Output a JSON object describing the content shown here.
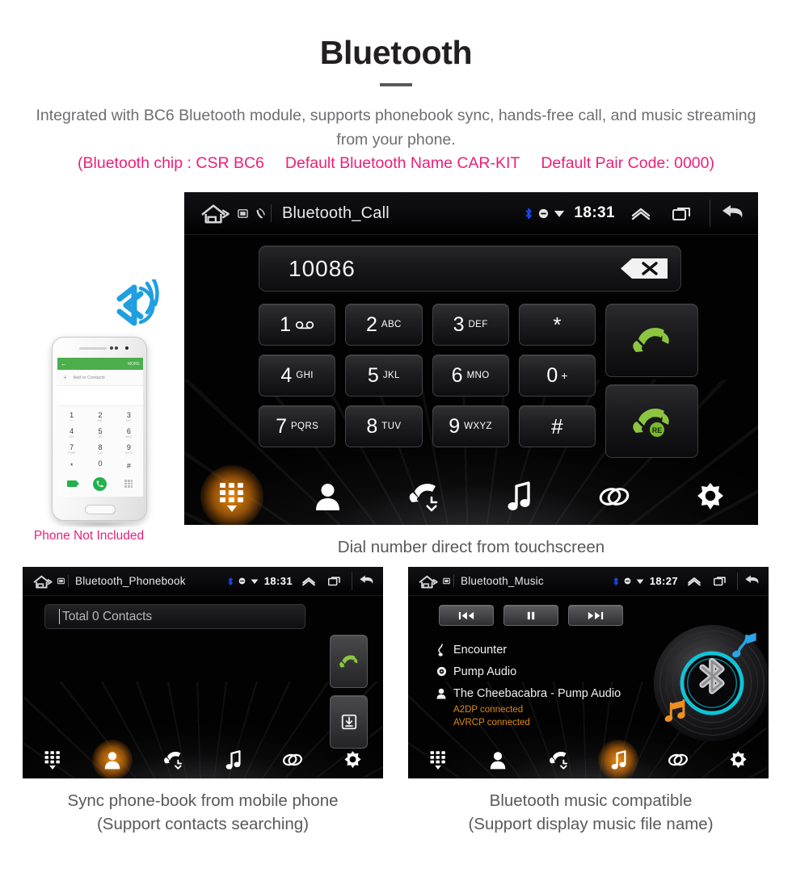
{
  "header": {
    "title": "Bluetooth",
    "subtitle": "Integrated with BC6 Bluetooth module, supports phonebook sync, hands-free call, and music streaming from your phone.",
    "spec_chip": "(Bluetooth chip : CSR BC6",
    "spec_name": "Default Bluetooth Name CAR-KIT",
    "spec_code": "Default Pair Code: 0000)",
    "accent_pink": "#ec1e79",
    "text_gray": "#6d6e71"
  },
  "phone_mockup": {
    "note": "Phone Not Included",
    "app_back_icon": "back-arrow-icon",
    "app_more_label": "MORE",
    "add_contact_label": "Add to Contacts",
    "keys": [
      {
        "digit": "1",
        "letters": "∞"
      },
      {
        "digit": "2",
        "letters": "ABC"
      },
      {
        "digit": "3",
        "letters": "DEF"
      },
      {
        "digit": "4",
        "letters": "GHI"
      },
      {
        "digit": "5",
        "letters": "JKL"
      },
      {
        "digit": "6",
        "letters": "MNO"
      },
      {
        "digit": "7",
        "letters": "PQRS"
      },
      {
        "digit": "8",
        "letters": "TUV"
      },
      {
        "digit": "9",
        "letters": "WXYZ"
      },
      {
        "digit": "*",
        "letters": ""
      },
      {
        "digit": "0",
        "letters": "+"
      },
      {
        "digit": "#",
        "letters": ""
      }
    ],
    "bluetooth_icon": "bluetooth-signal-icon",
    "call_color": "#22b14c"
  },
  "dialer": {
    "statusbar": {
      "home_icon": "home-icon",
      "sd_icon": "sd-card-icon",
      "phone_icon": "phone-small-icon",
      "title": "Bluetooth_Call",
      "bt_icon": "bluetooth-icon",
      "dnd_icon": "do-not-disturb-icon",
      "wifi_icon": "wifi-icon",
      "time": "18:31",
      "chevron_icon": "chevron-up-icon",
      "recents_icon": "recent-apps-icon",
      "back_icon": "back-icon"
    },
    "number": "10086",
    "delete_icon": "backspace-icon",
    "keys": [
      [
        {
          "digit": "1",
          "letters": "",
          "voicemail": true
        },
        {
          "digit": "2",
          "letters": "ABC"
        },
        {
          "digit": "3",
          "letters": "DEF"
        },
        {
          "digit": "*",
          "letters": "",
          "symbol": true
        }
      ],
      [
        {
          "digit": "4",
          "letters": "GHI"
        },
        {
          "digit": "5",
          "letters": "JKL"
        },
        {
          "digit": "6",
          "letters": "MNO"
        },
        {
          "digit": "0",
          "letters": "+",
          "plus": true
        }
      ],
      [
        {
          "digit": "7",
          "letters": "PQRS"
        },
        {
          "digit": "8",
          "letters": "TUV"
        },
        {
          "digit": "9",
          "letters": "WXYZ"
        },
        {
          "digit": "#",
          "letters": "",
          "symbol": true
        }
      ]
    ],
    "call_button": "call-button",
    "redial_button": "redial-button",
    "redial_badge": "RE",
    "call_green": "#8cc63f",
    "nav": [
      {
        "name": "dialpad",
        "active": true
      },
      {
        "name": "contacts",
        "active": false
      },
      {
        "name": "call-history",
        "active": false
      },
      {
        "name": "music",
        "active": false
      },
      {
        "name": "pair",
        "active": false
      },
      {
        "name": "settings",
        "active": false
      }
    ],
    "caption": "Dial number direct from touchscreen"
  },
  "phonebook": {
    "statusbar": {
      "title": "Bluetooth_Phonebook",
      "time": "18:31"
    },
    "search_value": "Total 0 Contacts",
    "call_button": "call-button",
    "download_button": "download-contacts-button",
    "nav": [
      {
        "name": "dialpad",
        "active": false
      },
      {
        "name": "contacts",
        "active": true
      },
      {
        "name": "call-history",
        "active": false
      },
      {
        "name": "music",
        "active": false
      },
      {
        "name": "pair",
        "active": false
      },
      {
        "name": "settings",
        "active": false
      }
    ],
    "caption_line1": "Sync phone-book from mobile phone",
    "caption_line2": "(Support contacts searching)"
  },
  "music": {
    "statusbar": {
      "title": "Bluetooth_Music",
      "time": "18:27"
    },
    "controls": [
      {
        "name": "previous",
        "icon": "skip-previous-icon"
      },
      {
        "name": "pause",
        "icon": "pause-icon"
      },
      {
        "name": "next",
        "icon": "skip-next-icon"
      }
    ],
    "track_title": "Encounter",
    "album": "Pump Audio",
    "artist": "The Cheebacabra - Pump Audio",
    "status_a2dp": "A2DP connected",
    "status_avrcp": "AVRCP connected",
    "status_color": "#e08a12",
    "disc_icon": "bluetooth-vinyl-icon",
    "nav": [
      {
        "name": "dialpad",
        "active": false
      },
      {
        "name": "contacts",
        "active": false
      },
      {
        "name": "call-history",
        "active": false
      },
      {
        "name": "music",
        "active": true
      },
      {
        "name": "pair",
        "active": false
      },
      {
        "name": "settings",
        "active": false
      }
    ],
    "caption_line1": "Bluetooth music compatible",
    "caption_line2": "(Support display music file name)"
  }
}
